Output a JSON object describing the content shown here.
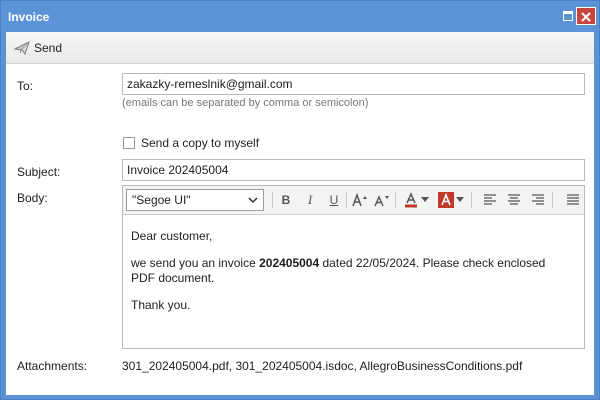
{
  "window": {
    "title": "Invoice"
  },
  "toolbar": {
    "send_label": "Send"
  },
  "form": {
    "to_label": "To:",
    "to_value": "zakazky-remeslnik@gmail.com",
    "to_hint": "(emails can be separated by comma or semicolon)",
    "copy_label": "Send a copy to myself",
    "copy_checked": false,
    "subject_label": "Subject:",
    "subject_value": "Invoice 202405004",
    "body_label": "Body:",
    "attachments_label": "Attachments:",
    "attachments_value": "301_202405004.pdf, 301_202405004.isdoc, AllegroBusinessConditions.pdf"
  },
  "editor": {
    "font": "\"Segoe UI\"",
    "bold_label": "B",
    "italic_label": "I",
    "underline_label": "U",
    "font_color": "#c0392b",
    "highlight_color": "#c0392b",
    "body": {
      "greeting": "Dear customer,",
      "line_prefix": "we send you an invoice ",
      "invoice_number": "202405004",
      "line_suffix": " dated 22/05/2024. Please check enclosed PDF document.",
      "closing": "Thank you."
    }
  },
  "icons": {
    "send": "send-plane-icon",
    "maximize": "maximize-icon",
    "close": "close-icon"
  },
  "colors": {
    "title_bar": "#5b93d6",
    "close_button": "#c7463f"
  }
}
